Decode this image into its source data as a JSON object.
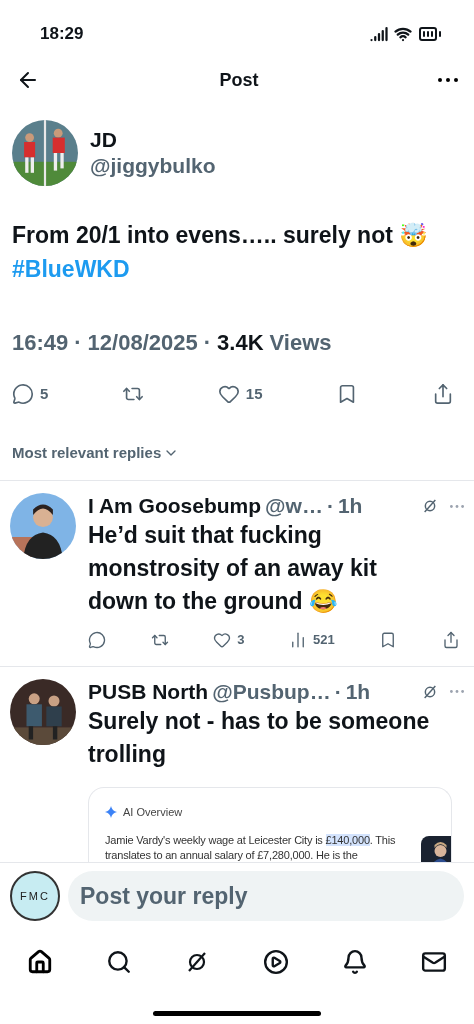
{
  "status_bar": {
    "time": "18:29"
  },
  "header": {
    "title": "Post"
  },
  "post": {
    "name": "JD",
    "handle": "@jiggybulko",
    "text": "From 20/1 into evens….. surely not 🤯",
    "hashtag": "#BlueWKD",
    "time": "16:49",
    "date": "12/08/2025",
    "separator": "·",
    "views_count": "3.4K",
    "views_label": "Views",
    "actions": [
      {
        "kind": "reply",
        "count": "5"
      },
      {
        "kind": "repost"
      },
      {
        "kind": "like",
        "count": "15"
      },
      {
        "kind": "bookmark"
      },
      {
        "kind": "share"
      }
    ]
  },
  "sort": {
    "label": "Most relevant replies"
  },
  "replies": [
    {
      "name": "I Am Goosebump",
      "handle": "@w…",
      "separator": "·",
      "age": "1h",
      "text": "He’d suit that fucking monstrosity of an away kit down to the ground 😂",
      "actions": [
        {
          "kind": "reply"
        },
        {
          "kind": "repost"
        },
        {
          "kind": "like",
          "count": "3"
        },
        {
          "kind": "views",
          "count": "521"
        },
        {
          "kind": "bookmark"
        },
        {
          "kind": "share"
        }
      ]
    },
    {
      "name": "PUSB North",
      "handle": "@Pusbup…",
      "separator": "·",
      "age": "1h",
      "text": "Surely not - has to be someone trolling",
      "embed": {
        "label": "AI Overview",
        "text_before": "Jamie Vardy's weekly wage at Leicester City is ",
        "highlight": "£140,000",
        "text_after": ". This translates to an annual salary of £7,280,000. He is the"
      }
    }
  ],
  "composer": {
    "avatar_text": "FMC",
    "placeholder": "Post your reply"
  },
  "tab_bar": [
    {
      "kind": "home",
      "selected": true
    },
    {
      "kind": "search",
      "selected": false
    },
    {
      "kind": "grok",
      "selected": false
    },
    {
      "kind": "video",
      "selected": false
    },
    {
      "kind": "notifications",
      "selected": false
    },
    {
      "kind": "messages",
      "selected": false
    }
  ]
}
